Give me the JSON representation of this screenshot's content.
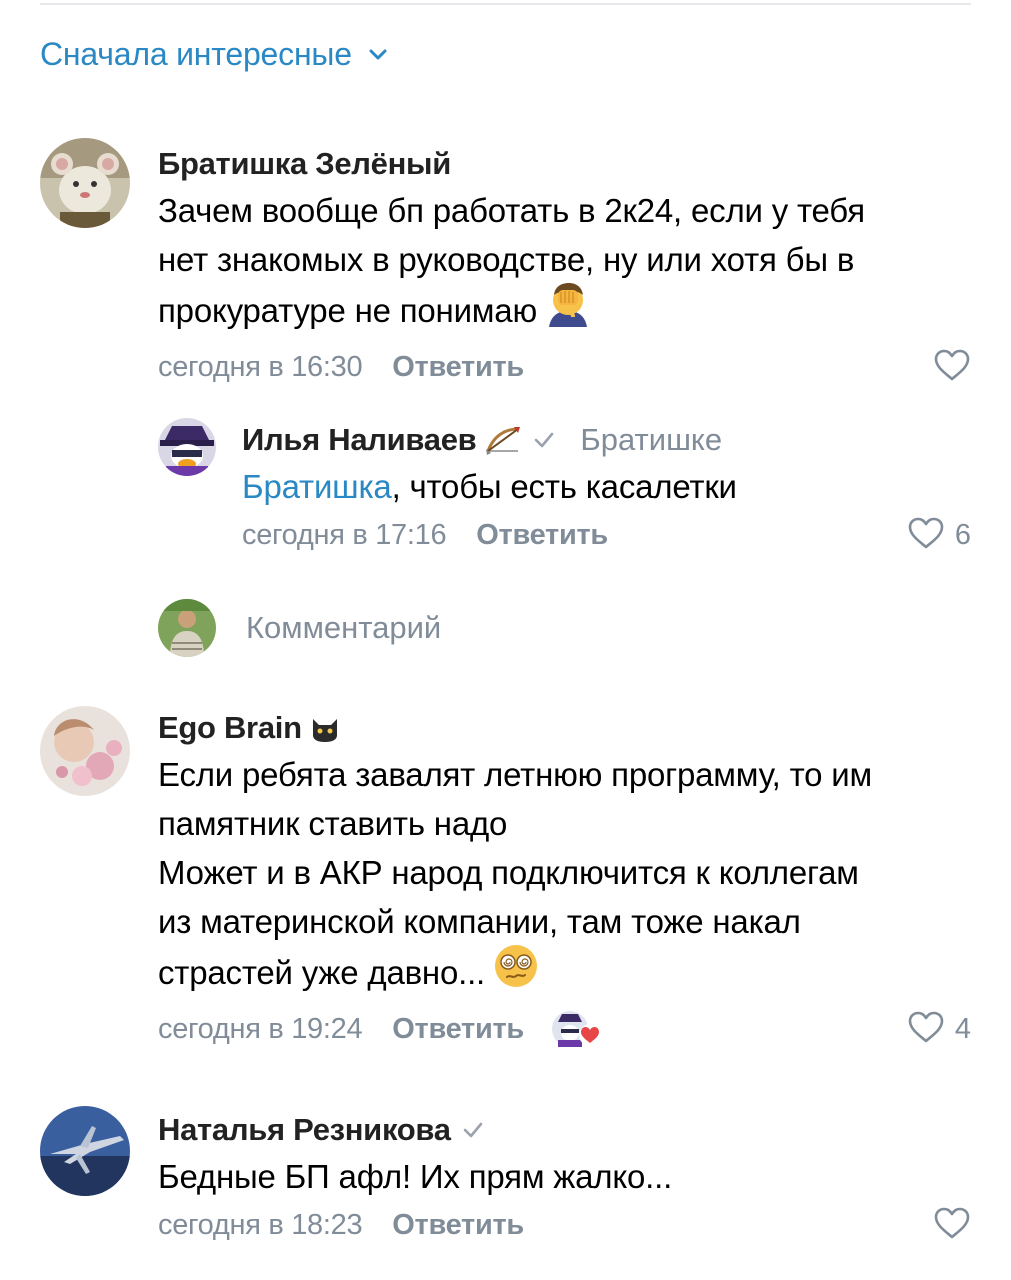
{
  "sort": {
    "label": "Сначала интересные"
  },
  "colors": {
    "accent": "#2a88c4",
    "secondary": "#818c99",
    "text": "#000000"
  },
  "comments": [
    {
      "author": "Братишка Зелёный",
      "text": [
        "Зачем вообще бп работать в 2к24, если у тебя",
        "нет знакомых в руководстве, ну или хотя бы в",
        "прокуратуре не понимаю"
      ],
      "emoji": "facepalm-emoji",
      "time": "сегодня в 16:30",
      "reply_label": "Ответить",
      "likes": ""
    },
    {
      "author": "Илья Наливаев",
      "author_badge": "bow-arrow-icon",
      "verified": true,
      "reply_to": "Братишке",
      "mention": "Братишка",
      "text": ", чтобы есть касалетки",
      "time": "сегодня в 17:16",
      "reply_label": "Ответить",
      "likes": "6"
    },
    {
      "author": "Ego Brain",
      "author_badge": "black-cat-icon",
      "text": [
        "Если ребята завалят летнюю программу, то им",
        "памятник ставить надо",
        "Может и в АКР народ подключится к коллегам",
        "из материнской компании, там тоже накал",
        "страстей уже давно..."
      ],
      "emoji": "dizzy-face-emoji",
      "time": "сегодня в 19:24",
      "reply_label": "Ответить",
      "likes": "4"
    },
    {
      "author": "Наталья Резникова",
      "verified": true,
      "text": [
        "Бедные БП афл! Их прям жалко..."
      ],
      "time": "сегодня в 18:23",
      "reply_label": "Ответить",
      "likes": ""
    }
  ],
  "comment_input": {
    "placeholder": "Комментарий"
  }
}
